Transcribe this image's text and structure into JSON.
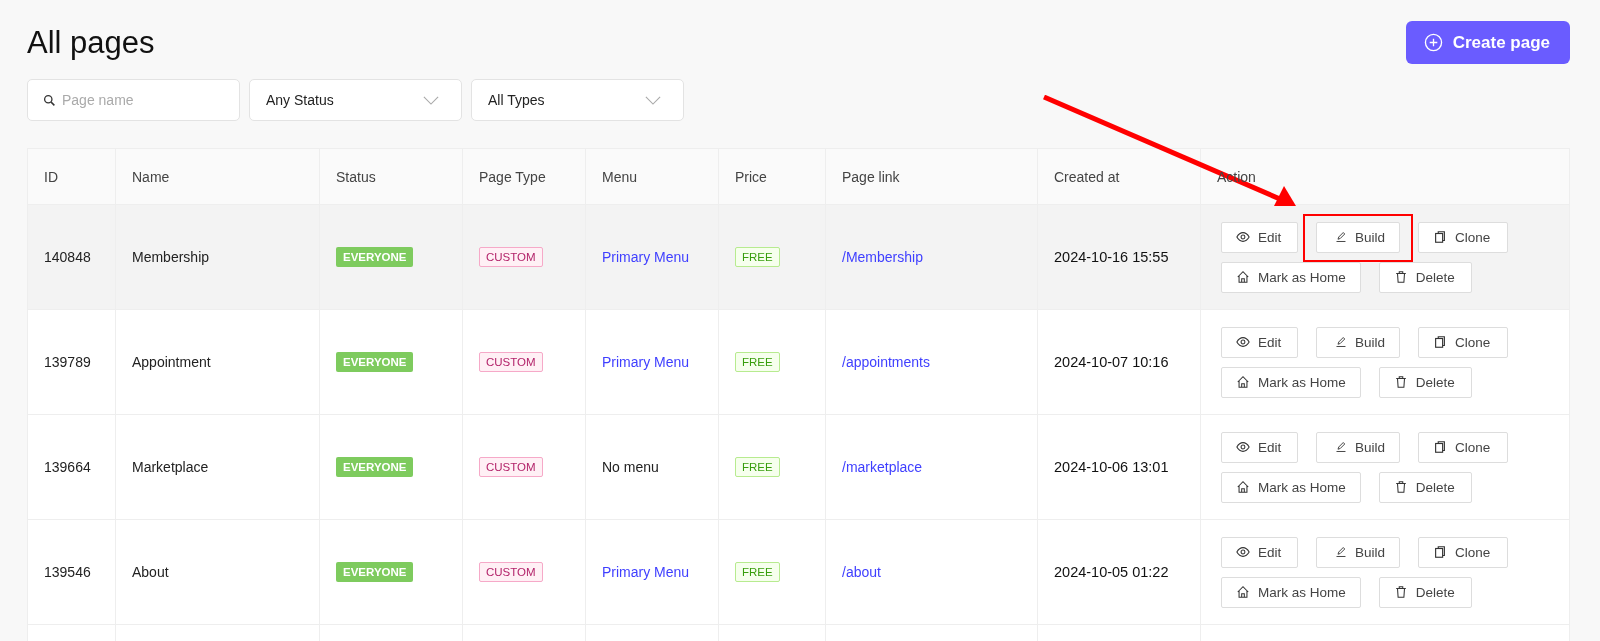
{
  "title": "All pages",
  "create_button": {
    "label": "Create page"
  },
  "filters": {
    "search": {
      "placeholder": "Page name"
    },
    "status": {
      "value": "Any Status"
    },
    "type": {
      "value": "All Types"
    }
  },
  "annotation_arrow": true,
  "table": {
    "columns": [
      "ID",
      "Name",
      "Status",
      "Page Type",
      "Menu",
      "Price",
      "Page link",
      "Created at",
      "Action"
    ],
    "rows": [
      {
        "id": "140848",
        "name": "Membership",
        "status": "EVERYONE",
        "page_type": "CUSTOM",
        "menu": "Primary Menu",
        "menu_linked": true,
        "price": "FREE",
        "link": "/Membership",
        "created": "2024-10-16 15:55",
        "hovered": true,
        "actions": [
          {
            "kind": "edit",
            "label": "Edit",
            "highlighted": false
          },
          {
            "kind": "build",
            "label": "Build",
            "highlighted": true
          },
          {
            "kind": "clone",
            "label": "Clone",
            "highlighted": false
          },
          {
            "kind": "home",
            "label": "Mark as Home",
            "highlighted": false
          },
          {
            "kind": "delete",
            "label": "Delete",
            "highlighted": false
          }
        ]
      },
      {
        "id": "139789",
        "name": "Appointment",
        "status": "EVERYONE",
        "page_type": "CUSTOM",
        "menu": "Primary Menu",
        "menu_linked": true,
        "price": "FREE",
        "link": "/appointments",
        "created": "2024-10-07 10:16",
        "hovered": false,
        "actions": [
          {
            "kind": "edit",
            "label": "Edit",
            "highlighted": false
          },
          {
            "kind": "build",
            "label": "Build",
            "highlighted": false
          },
          {
            "kind": "clone",
            "label": "Clone",
            "highlighted": false
          },
          {
            "kind": "home",
            "label": "Mark as Home",
            "highlighted": false
          },
          {
            "kind": "delete",
            "label": "Delete",
            "highlighted": false
          }
        ]
      },
      {
        "id": "139664",
        "name": "Marketplace",
        "status": "EVERYONE",
        "page_type": "CUSTOM",
        "menu": "No menu",
        "menu_linked": false,
        "price": "FREE",
        "link": "/marketplace",
        "created": "2024-10-06 13:01",
        "hovered": false,
        "actions": [
          {
            "kind": "edit",
            "label": "Edit",
            "highlighted": false
          },
          {
            "kind": "build",
            "label": "Build",
            "highlighted": false
          },
          {
            "kind": "clone",
            "label": "Clone",
            "highlighted": false
          },
          {
            "kind": "home",
            "label": "Mark as Home",
            "highlighted": false
          },
          {
            "kind": "delete",
            "label": "Delete",
            "highlighted": false
          }
        ]
      },
      {
        "id": "139546",
        "name": "About",
        "status": "EVERYONE",
        "page_type": "CUSTOM",
        "menu": "Primary Menu",
        "menu_linked": true,
        "price": "FREE",
        "link": "/about",
        "created": "2024-10-05 01:22",
        "hovered": false,
        "actions": [
          {
            "kind": "edit",
            "label": "Edit",
            "highlighted": false
          },
          {
            "kind": "build",
            "label": "Build",
            "highlighted": false
          },
          {
            "kind": "clone",
            "label": "Clone",
            "highlighted": false
          },
          {
            "kind": "home",
            "label": "Mark as Home",
            "highlighted": false
          },
          {
            "kind": "delete",
            "label": "Delete",
            "highlighted": false
          }
        ]
      }
    ]
  }
}
